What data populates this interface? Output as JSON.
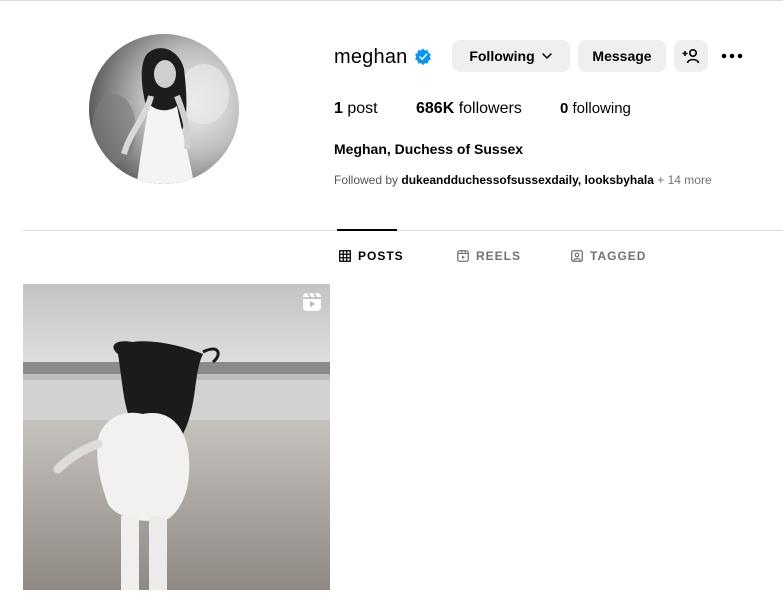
{
  "profile": {
    "username": "meghan",
    "verified": true,
    "full_name": "Meghan, Duchess of Sussex",
    "stats": {
      "posts_count": "1",
      "posts_label": "post",
      "followers_count": "686K",
      "followers_label": "followers",
      "following_count": "0",
      "following_label": "following"
    },
    "followed_by": {
      "prefix": "Followed by",
      "accounts": "dukeandduchessofsussexdaily, looksbyhala",
      "more": "+ 14 more"
    }
  },
  "actions": {
    "following_label": "Following",
    "message_label": "Message"
  },
  "tabs": {
    "posts": "POSTS",
    "reels": "REELS",
    "tagged": "TAGGED"
  },
  "icons": {
    "verified": "verified-badge-icon",
    "following_dropdown": "chevron-down-icon",
    "add_user": "add-user-icon",
    "more": "more-options-icon",
    "posts_tab": "grid-icon",
    "reels_tab": "reels-icon",
    "tagged_tab": "tagged-icon",
    "post_type": "reel-icon"
  },
  "colors": {
    "verified_blue": "#0095f6",
    "button_bg": "#efefef",
    "muted_text": "#737373"
  }
}
